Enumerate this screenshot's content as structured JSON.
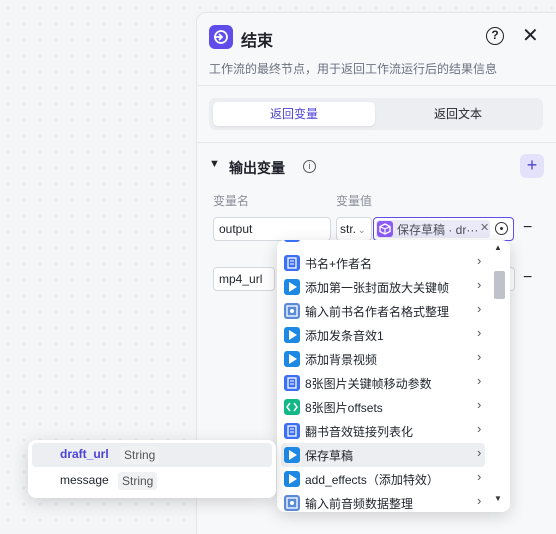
{
  "header": {
    "title": "结束",
    "help_icon": "question-circle-icon",
    "close_icon": "close-icon",
    "accent": "#5f4cea"
  },
  "description": "工作流的最终节点，用于返回工作流运行后的结果信息",
  "tabs": [
    {
      "label": "返回变量",
      "active": true
    },
    {
      "label": "返回文本",
      "active": false
    }
  ],
  "output_section": {
    "title": "输出变量",
    "col_name": "变量名",
    "col_value": "变量值",
    "rows": [
      {
        "name": "output",
        "type": "str.",
        "ref_label": "保存草稿 · dr··· "
      },
      {
        "name": "mp4_url"
      }
    ]
  },
  "node_list": {
    "items": [
      {
        "label": "书名+作者名",
        "icon": "blue-doc-icon"
      },
      {
        "label": "添加第一张封面放大关键帧",
        "icon": "blue-play-icon"
      },
      {
        "label": "输入前书名作者名格式整理",
        "icon": "code-icon"
      },
      {
        "label": "添加发条音效1",
        "icon": "blue-play-icon"
      },
      {
        "label": "添加背景视频",
        "icon": "blue-play-icon"
      },
      {
        "label": "8张图片关键帧移动参数",
        "icon": "blue-doc-icon"
      },
      {
        "label": "8张图片offsets",
        "icon": "teal-code-icon"
      },
      {
        "label": "翻书音效链接列表化",
        "icon": "blue-doc-icon"
      },
      {
        "label": "保存草稿",
        "icon": "blue-play-icon",
        "hover": true
      },
      {
        "label": "add_effects（添加特效）",
        "icon": "blue-play-icon"
      },
      {
        "label": "输入前音频数据整理",
        "icon": "code-icon"
      }
    ]
  },
  "sub_vars": [
    {
      "name": "draft_url",
      "type": "String",
      "selected": true
    },
    {
      "name": "message",
      "type": "String",
      "selected": false
    }
  ]
}
